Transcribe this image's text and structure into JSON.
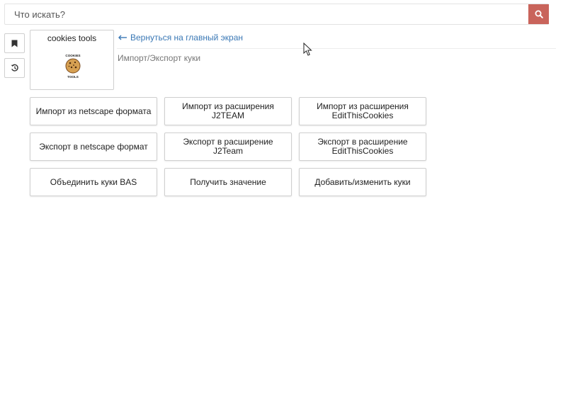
{
  "search": {
    "placeholder": "Что искать?"
  },
  "sidebar": {
    "bookmark_icon": "bookmark-icon",
    "history_icon": "history-icon"
  },
  "tool": {
    "title": "cookies tools",
    "logo_text_top": "COOKIES",
    "logo_text_bottom": "TOOLS"
  },
  "nav": {
    "back_label": "Вернуться на главный экран",
    "breadcrumb": "Импорт/Экспорт куки"
  },
  "actions": [
    [
      "Импорт из netscape формата",
      "Импорт из расширения J2TEAM",
      "Импорт из расширения EditThisCookies"
    ],
    [
      "Экспорт в netscape формат",
      "Экспорт в расширение J2Team",
      "Экспорт в расширение EditThisCookies"
    ],
    [
      "Объединить куки BAS",
      "Получить значение",
      "Добавить/изменить куки"
    ]
  ],
  "colors": {
    "accent": "#c9645b",
    "link": "#3a78b5"
  }
}
